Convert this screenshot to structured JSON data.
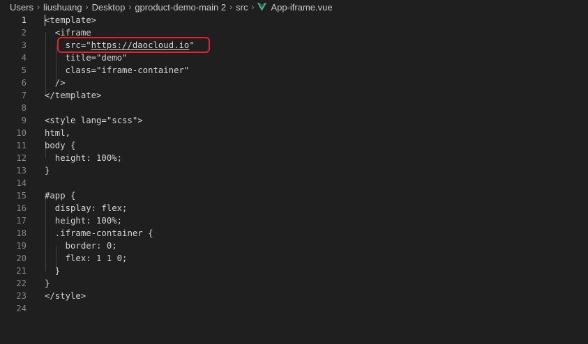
{
  "breadcrumb": {
    "items": [
      "Users",
      "liushuang",
      "Desktop",
      "gproduct-demo-main 2",
      "src"
    ],
    "file": "App-iframe.vue",
    "file_icon": "vue-icon",
    "separator": "chevron-right-icon"
  },
  "editor": {
    "active_line": 1,
    "lines": [
      {
        "n": "1",
        "text": "<template>"
      },
      {
        "n": "2",
        "text": "  <iframe"
      },
      {
        "n": "3",
        "prefix": "    src=\"",
        "link": "https://daocloud.io",
        "suffix": "\""
      },
      {
        "n": "4",
        "text": "    title=\"demo\""
      },
      {
        "n": "5",
        "text": "    class=\"iframe-container\""
      },
      {
        "n": "6",
        "text": "  />"
      },
      {
        "n": "7",
        "text": "</template>"
      },
      {
        "n": "8",
        "text": ""
      },
      {
        "n": "9",
        "text": "<style lang=\"scss\">"
      },
      {
        "n": "10",
        "text": "html,"
      },
      {
        "n": "11",
        "text": "body {"
      },
      {
        "n": "12",
        "text": "  height: 100%;"
      },
      {
        "n": "13",
        "text": "}"
      },
      {
        "n": "14",
        "text": ""
      },
      {
        "n": "15",
        "text": "#app {"
      },
      {
        "n": "16",
        "text": "  display: flex;"
      },
      {
        "n": "17",
        "text": "  height: 100%;"
      },
      {
        "n": "18",
        "text": "  .iframe-container {"
      },
      {
        "n": "19",
        "text": "    border: 0;"
      },
      {
        "n": "20",
        "text": "    flex: 1 1 0;"
      },
      {
        "n": "21",
        "text": "  }"
      },
      {
        "n": "22",
        "text": "}"
      },
      {
        "n": "23",
        "text": "</style>"
      },
      {
        "n": "24",
        "text": ""
      }
    ]
  },
  "colors": {
    "background": "#1f1f1f",
    "highlight_box": "#e5212b",
    "vue_green": "#42b883"
  }
}
